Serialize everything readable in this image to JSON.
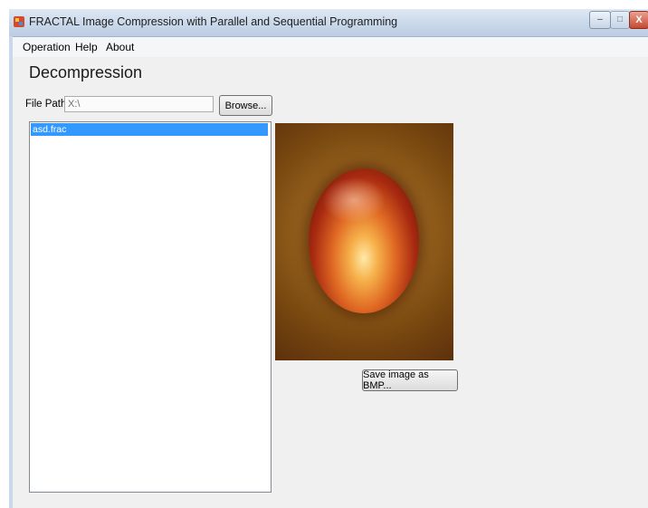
{
  "window": {
    "title": "FRACTAL Image Compression with Parallel and Sequential Programming",
    "controls": {
      "minimize": "–",
      "maximize": "□",
      "close": "X"
    }
  },
  "menu": {
    "items": [
      "Operation",
      "Help",
      "About"
    ]
  },
  "panel": {
    "heading": "Decompression",
    "file_path_label": "File Path",
    "file_path_value": "X:\\",
    "browse_label": "Browse...",
    "files": [
      "asd.frac"
    ],
    "selected_file_index": 0,
    "save_label": "Save image as BMP..."
  },
  "icons": {
    "app": "fractal-app-icon",
    "close": "close-icon",
    "minimize": "minimize-icon",
    "maximize": "maximize-icon"
  },
  "colors": {
    "selection": "#3399ff",
    "titlebar": "#c9d8ea",
    "close_button": "#c54a30"
  }
}
